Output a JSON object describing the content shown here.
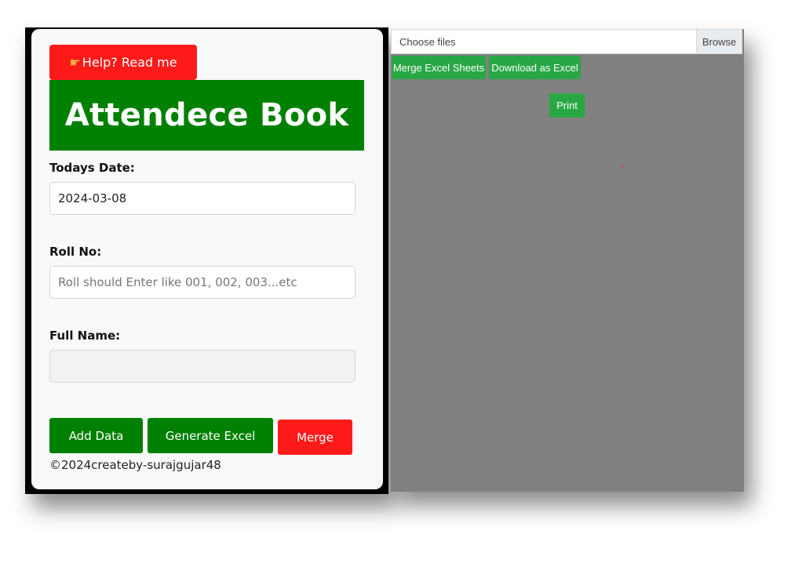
{
  "left_panel": {
    "help_button": {
      "label": "Help? Read me",
      "icon": "pointing-hand-icon"
    },
    "title": "Attendece Book",
    "date_field": {
      "label": "Todays Date:",
      "value": "2024-03-08"
    },
    "roll_field": {
      "label": "Roll No:",
      "placeholder": "Roll should Enter like 001, 002, 003...etc"
    },
    "name_field": {
      "label": "Full Name:",
      "value": ""
    },
    "buttons": {
      "add_data": "Add Data",
      "generate_excel": "Generate Excel",
      "merge": "Merge"
    },
    "footer": "©2024createby-surajgujar48"
  },
  "right_panel": {
    "file_input": {
      "placeholder": "Choose files",
      "browse_label": "Browse"
    },
    "merge_excel_sheets": "Merge Excel Sheets",
    "download_as_excel": "Download as Excel",
    "print": "Print"
  },
  "colors": {
    "primary_green": "#008000",
    "action_green": "#28a745",
    "danger_red": "#ff1a1a",
    "pane_gray": "#808080"
  }
}
